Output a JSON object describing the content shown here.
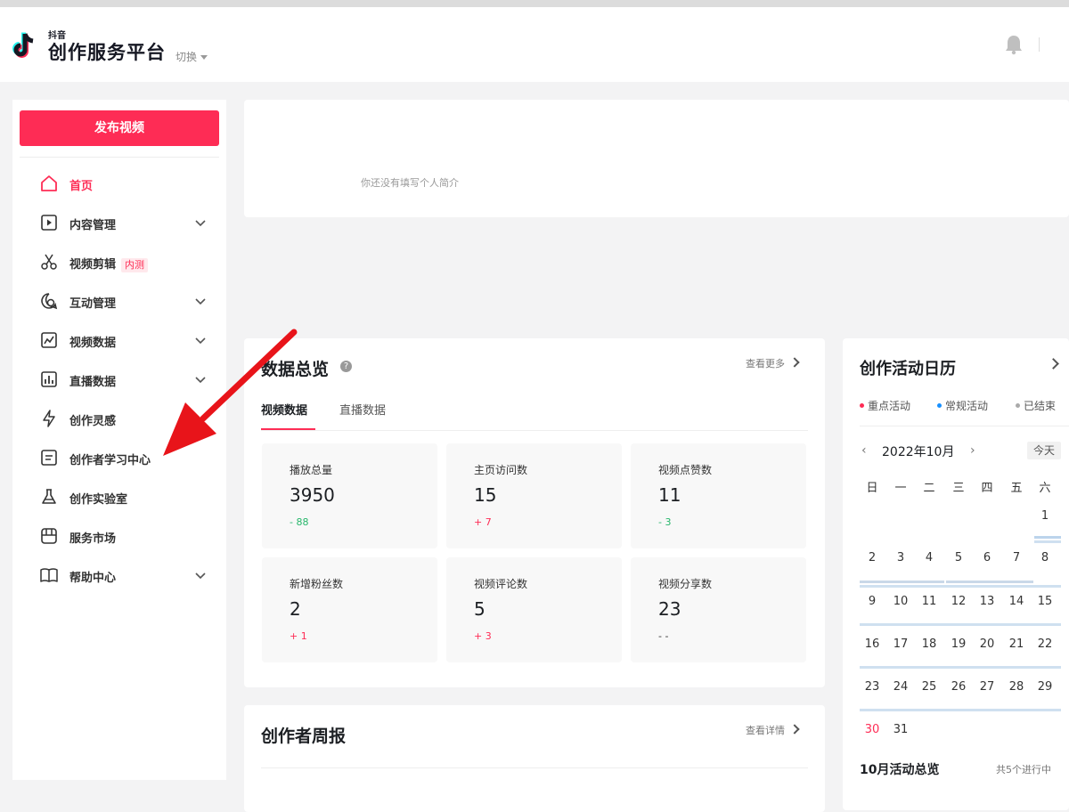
{
  "header": {
    "logo_small": "抖音",
    "logo_main": "创作服务平台",
    "switch_label": "切换"
  },
  "sidebar": {
    "publish_label": "发布视频",
    "items": [
      {
        "label": "首页",
        "icon": "home-icon",
        "active": true
      },
      {
        "label": "内容管理",
        "icon": "play-box-icon",
        "expandable": true
      },
      {
        "label": "视频剪辑",
        "icon": "scissors-icon",
        "badge": "内测"
      },
      {
        "label": "互动管理",
        "icon": "chat-icon",
        "expandable": true
      },
      {
        "label": "视频数据",
        "icon": "line-chart-icon",
        "expandable": true
      },
      {
        "label": "直播数据",
        "icon": "bar-chart-icon",
        "expandable": true
      },
      {
        "label": "创作灵感",
        "icon": "lightning-icon"
      },
      {
        "label": "创作者学习中心",
        "icon": "document-icon"
      },
      {
        "label": "创作实验室",
        "icon": "flask-icon"
      },
      {
        "label": "服务市场",
        "icon": "store-icon"
      },
      {
        "label": "帮助中心",
        "icon": "book-icon",
        "expandable": true
      }
    ]
  },
  "profile": {
    "bio_placeholder": "你还没有填写个人简介"
  },
  "overview": {
    "title": "数据总览",
    "more_label": "查看更多",
    "tabs": [
      "视频数据",
      "直播数据"
    ],
    "stats": [
      {
        "label": "播放总量",
        "value": "3950",
        "delta": "- 88",
        "trend": "down"
      },
      {
        "label": "主页访问数",
        "value": "15",
        "delta": "+ 7",
        "trend": "up"
      },
      {
        "label": "视频点赞数",
        "value": "11",
        "delta": "- 3",
        "trend": "down"
      },
      {
        "label": "新增粉丝数",
        "value": "2",
        "delta": "+ 1",
        "trend": "up"
      },
      {
        "label": "视频评论数",
        "value": "5",
        "delta": "+ 3",
        "trend": "up"
      },
      {
        "label": "视频分享数",
        "value": "23",
        "delta": "- -",
        "trend": "none"
      }
    ]
  },
  "weekly": {
    "title": "创作者周报",
    "more_label": "查看详情"
  },
  "calendar": {
    "title": "创作活动日历",
    "legend": [
      "重点活动",
      "常规活动",
      "已结束"
    ],
    "month_label": "2022年10月",
    "today_label": "今天",
    "weekdays": [
      "日",
      "一",
      "二",
      "三",
      "四",
      "五",
      "六"
    ],
    "days": [
      "1",
      "2",
      "3",
      "4",
      "5",
      "6",
      "7",
      "8",
      "9",
      "10",
      "11",
      "12",
      "13",
      "14",
      "15",
      "16",
      "17",
      "18",
      "19",
      "20",
      "21",
      "22",
      "23",
      "24",
      "25",
      "26",
      "27",
      "28",
      "29",
      "30",
      "31"
    ],
    "footer_title": "10月活动总览",
    "footer_count": "共5个进行中"
  },
  "colors": {
    "brand": "#fe2c55",
    "green": "#27b66b",
    "blue": "#1890ff",
    "gray": "#aaaaaa",
    "annotation_arrow": "#e8141a"
  }
}
